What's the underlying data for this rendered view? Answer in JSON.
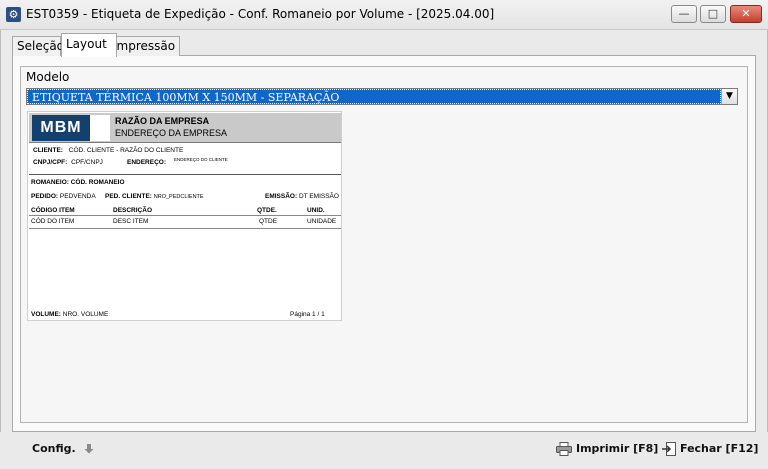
{
  "window": {
    "title": "EST0359 - Etiqueta de Expedição - Conf. Romaneio por Volume - [2025.04.00]",
    "min_glyph": "—",
    "max_glyph": "□",
    "close_glyph": "✕"
  },
  "tabs": [
    {
      "label": "Seleção"
    },
    {
      "label": "Layout",
      "active": true
    },
    {
      "label": "Impressão"
    }
  ],
  "modelo": {
    "label": "Modelo",
    "value": "ETIQUETA TÉRMICA 100MM X 150MM - SEPARAÇÃO",
    "arrow_glyph": "▼"
  },
  "preview": {
    "logo_text": "MBM",
    "company_name": "RAZÃO DA EMPRESA",
    "company_address": "ENDEREÇO DA EMPRESA",
    "cliente_label": "CLIENTE:",
    "cliente_value": "CÓD. CLIENTE - RAZÃO DO CLIENTE",
    "cnpj_label": "CNPJ/CPF:",
    "cnpj_value": "CPF/CNPJ",
    "endereco_label": "ENDEREÇO:",
    "endereco_value": "ENDEREÇO DO CLIENTE",
    "romaneio_label": "ROMANEIO:",
    "romaneio_value": "CÓD. ROMANEIO",
    "pedido_label": "PEDIDO:",
    "pedido_value": "PEDVENDA",
    "ped_cliente_label": "PED. CLIENTE:",
    "ped_cliente_value": "NRO_PEDCLIENTE",
    "emissao_label": "EMISSÃO:",
    "emissao_value": "DT EMISSÃO",
    "columns": [
      "CÓDIGO ITEM",
      "DESCRIÇÃO",
      "QTDE.",
      "UNID."
    ],
    "row": [
      "CÓD DO ITEM",
      "DESC ITEM",
      "QTDE",
      "UNIDADE"
    ],
    "volume_label": "VOLUME:",
    "volume_value": "NRO. VOLUME",
    "page_text": "Página 1 / 1"
  },
  "bottom": {
    "config_label": "Config.",
    "imprimir_label": "Imprimir [F8]",
    "fechar_label": "Fechar [F12]"
  }
}
